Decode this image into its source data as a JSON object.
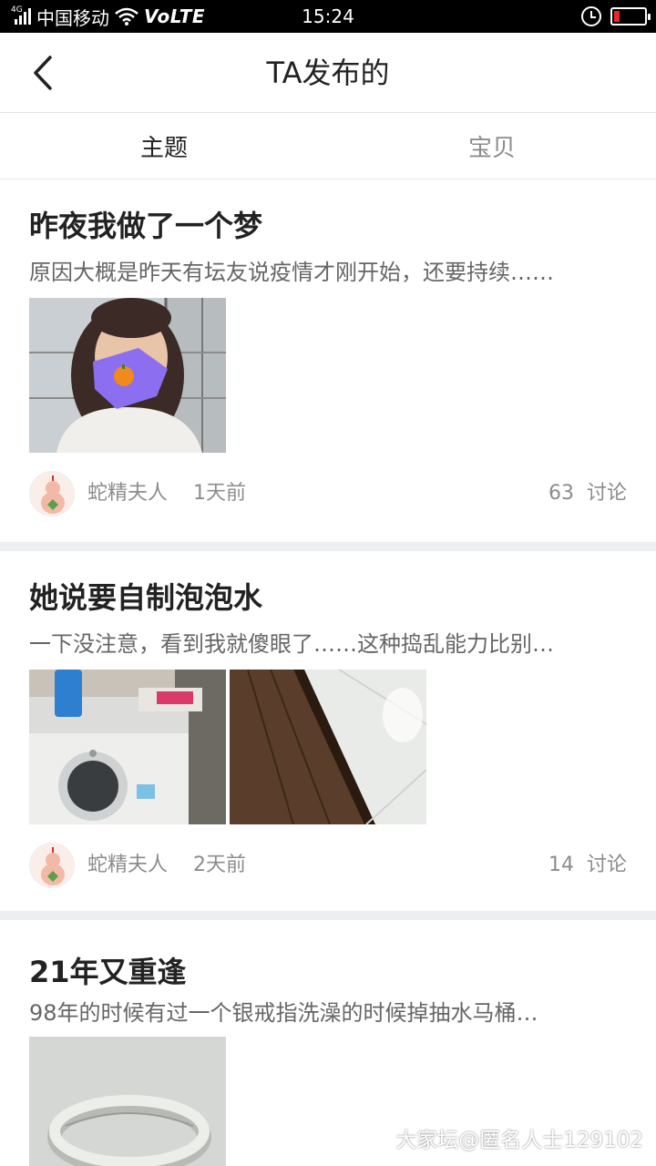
{
  "status_bar": {
    "network": "4G",
    "carrier": "中国移动",
    "volte": "VoLTE",
    "time": "15:24",
    "battery_color": "#e8262b",
    "battery_level": 0.2,
    "icons": [
      "signal-icon",
      "wifi-icon",
      "alarm-icon",
      "battery-icon"
    ]
  },
  "header": {
    "title": "TA发布的",
    "back_icon": "chevron-left-icon"
  },
  "tabs": [
    {
      "label": "主题",
      "active": true
    },
    {
      "label": "宝贝",
      "active": false
    }
  ],
  "posts": [
    {
      "title": "昨夜我做了一个梦",
      "excerpt": "原因大概是昨天有坛友说疫情才刚开始，还要持续……",
      "author": "蛇精夫人",
      "time": "1天前",
      "comment_count": "63",
      "comment_label": "讨论",
      "images": [
        "selfie-photo"
      ]
    },
    {
      "title": "她说要自制泡泡水",
      "excerpt": "一下没注意，看到我就傻眼了……这种捣乱能力比别…",
      "author": "蛇精夫人",
      "time": "2天前",
      "comment_count": "14",
      "comment_label": "讨论",
      "images": [
        "washing-machine-photo",
        "wet-floor-photo"
      ]
    },
    {
      "title": "21年又重逢",
      "excerpt": "98年的时候有过一个银戒指洗澡的时候掉抽水马桶…",
      "images": [
        "silver-ring-photo"
      ]
    }
  ],
  "watermark": "大家坛@匿名人士129102",
  "colors": {
    "divider": "#eceef1",
    "meta_text": "#8c8c8c",
    "title_text": "#222222"
  }
}
